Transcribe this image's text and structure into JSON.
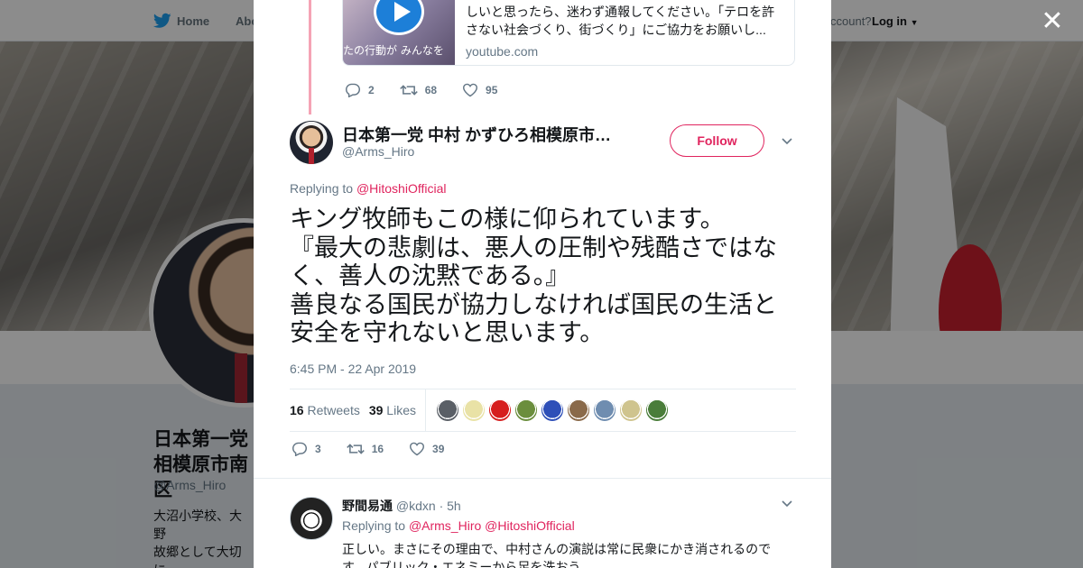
{
  "nav": {
    "home": "Home",
    "about": "Abo",
    "account_prompt": "ccount?",
    "login": "Log in"
  },
  "profile_bg": {
    "name": "日本第一党\n相模原市南区",
    "handle": "@Arms_Hiro",
    "bio": "大沼小学校、大野\n故郷として大切に\n本には新しい保守\n守、且つ経済的に"
  },
  "link_card": {
    "thumb_text": "たの行動が みんなを",
    "description": "しいと思ったら、迷わず通報してください。「テロを許さない社会づくり、街づくり」にご協力をお願いし...",
    "domain": "youtube.com"
  },
  "prev_actions": {
    "replies": "2",
    "retweets": "68",
    "likes": "95"
  },
  "tweet": {
    "author_name": "日本第一党 中村 かずひろ相模原市南区選挙区",
    "author_handle": "@Arms_Hiro",
    "follow_label": "Follow",
    "replying_prefix": "Replying to",
    "replying_to": "@HitoshiOfficial",
    "text_lines": [
      "キング牧師もこの様に仰られています。",
      "『最大の悲劇は、悪人の圧制や残酷さではな",
      "く、善人の沈黙である。』",
      "善良なる国民が協力しなければ国民の生活と",
      "安全を守れないと思います。"
    ],
    "time": "6:45 PM - 22 Apr 2019",
    "retweets_count": "16",
    "retweets_label": "Retweets",
    "likes_count": "39",
    "likes_label": "Likes",
    "actions": {
      "replies": "3",
      "retweets": "16",
      "likes": "39"
    }
  },
  "likers": [
    {
      "name": "liker-1",
      "color": "#5a5f66"
    },
    {
      "name": "liker-2",
      "color": "#e9e2a6"
    },
    {
      "name": "liker-3",
      "color": "#d61f1f"
    },
    {
      "name": "liker-4",
      "color": "#6b8e3d"
    },
    {
      "name": "liker-5",
      "color": "#2e4fb8"
    },
    {
      "name": "liker-6",
      "color": "#8a6a4a"
    },
    {
      "name": "liker-7",
      "color": "#6f8db0"
    },
    {
      "name": "liker-8",
      "color": "#cfc48e"
    },
    {
      "name": "liker-9",
      "color": "#4a7d3a"
    }
  ],
  "reply": {
    "name": "野間易通",
    "handle": "@kdxn",
    "time": "· 5h",
    "replying_prefix": "Replying to",
    "replying_to": "@Arms_Hiro @HitoshiOfficial",
    "text": "正しい。まさにその理由で、中村さんの演説は常に民衆にかき消されるのです。パブリック・エネミーから足を洗おう"
  },
  "colors": {
    "accent": "#e0245e",
    "text_secondary": "#657786",
    "twitter_blue": "#1da1f2"
  }
}
